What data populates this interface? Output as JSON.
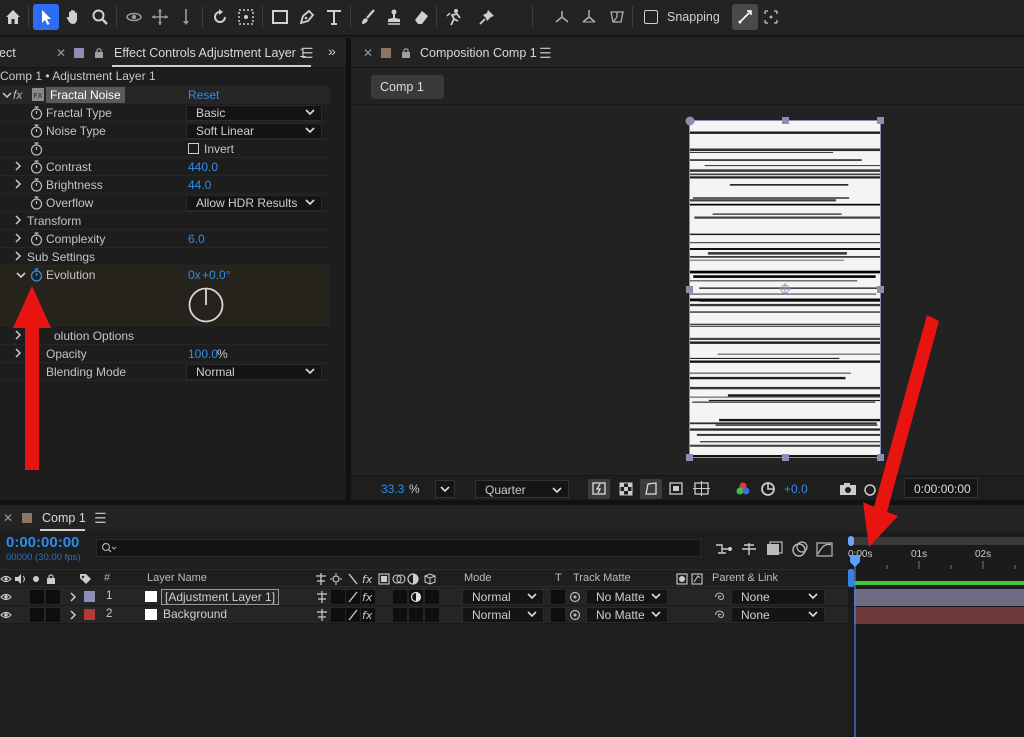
{
  "toolbar": {
    "tools": [
      "home-icon",
      "selection-tool-icon",
      "hand-tool-icon",
      "zoom-tool-icon",
      "orbit-camera-icon",
      "pan-camera-icon",
      "dolly-camera-icon",
      "rotate-tool-icon",
      "pan-behind-icon",
      "rectangle-tool-icon",
      "pen-tool-icon",
      "type-tool-icon",
      "brush-tool-icon",
      "clone-stamp-icon",
      "eraser-icon",
      "roto-brush-icon",
      "puppet-pin-icon"
    ],
    "axis_tools": [
      "local-axis-icon",
      "world-axis-icon",
      "view-axis-icon"
    ],
    "snapping_label": "Snapping"
  },
  "effect_controls": {
    "partial_tab": "ect",
    "tab_title": "Effect Controls Adjustment Layer 1",
    "breadcrumb": "Comp 1 • Adjustment Layer 1",
    "effect_badge": "fx",
    "effect_name": "Fractal Noise",
    "reset_label": "Reset",
    "rows": {
      "fractal_type": {
        "label": "Fractal Type",
        "value": "Basic"
      },
      "noise_type": {
        "label": "Noise Type",
        "value": "Soft Linear"
      },
      "invert": {
        "label": "Invert",
        "checked": false
      },
      "contrast": {
        "label": "Contrast",
        "value": "440.0"
      },
      "brightness": {
        "label": "Brightness",
        "value": "44.0"
      },
      "overflow": {
        "label": "Overflow",
        "value": "Allow HDR Results"
      },
      "transform": {
        "label": "Transform"
      },
      "complexity": {
        "label": "Complexity",
        "value": "6.0"
      },
      "sub_settings": {
        "label": "Sub Settings"
      },
      "evolution": {
        "label": "Evolution",
        "value_a": "0x",
        "value_b": "+0.0°"
      },
      "evolution_options": {
        "label": "olution Options"
      },
      "opacity": {
        "label": "Opacity",
        "value": "100.0",
        "unit": "%"
      },
      "blending_mode": {
        "label": "Blending Mode",
        "value": "Normal"
      }
    }
  },
  "composition": {
    "tab_title": "Composition Comp 1",
    "comp_button": "Comp 1",
    "zoom_value": "33.3",
    "zoom_unit": "%",
    "resolution": "Quarter",
    "exposure": "+0.0",
    "timecode": "0:00:00:00",
    "accent_color": "#2d8ceb"
  },
  "timeline": {
    "tab_title": "Comp 1",
    "timecode": "0:00:00:00",
    "frame_info": "00000 (30.00 fps)",
    "search_placeholder": "",
    "ruler": [
      "0:00s",
      "01s",
      "02s"
    ],
    "columns": {
      "number": "#",
      "layer_name": "Layer Name",
      "mode": "Mode",
      "t": "T",
      "track_matte": "Track Matte",
      "parent": "Parent & Link"
    },
    "layers": [
      {
        "num": "1",
        "name": "[Adjustment Layer 1]",
        "color": "#8d8db6",
        "mode": "Normal",
        "matte": "No Matte",
        "parent": "None",
        "bar_color": "#6f6b82"
      },
      {
        "num": "2",
        "name": "Background",
        "color": "#b33a3a",
        "mode": "Normal",
        "matte": "No Matte",
        "parent": "None",
        "bar_color": "#6e3a3c"
      }
    ],
    "work_area_color": "#3ec73e"
  },
  "annotations": {
    "arrow_color": "#e8140f"
  }
}
